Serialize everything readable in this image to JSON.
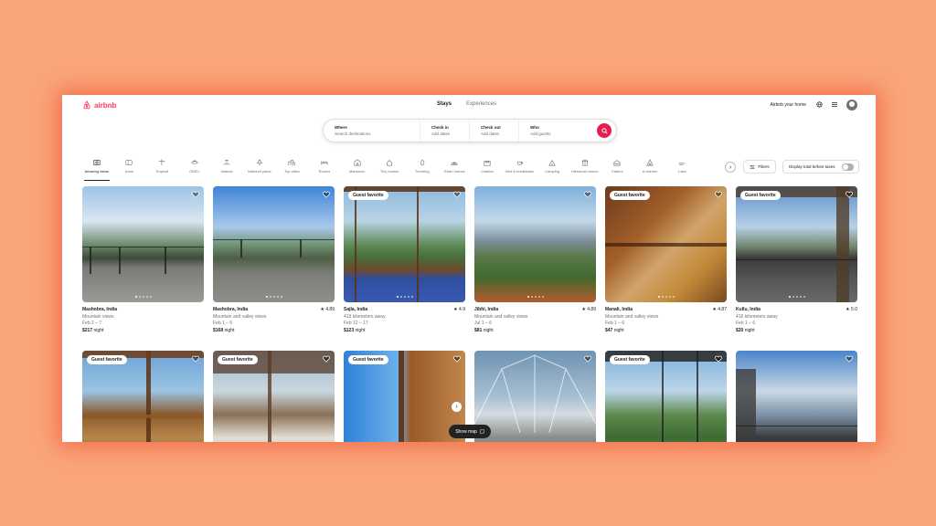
{
  "brand": {
    "name": "airbnb",
    "color": "#ff385c"
  },
  "nav": {
    "tabs": [
      "Stays",
      "Experiences"
    ],
    "host_link": "Airbnb your home"
  },
  "search": {
    "where_label": "Where",
    "where_placeholder": "Search destinations",
    "checkin_label": "Check in",
    "checkin_placeholder": "Add dates",
    "checkout_label": "Check out",
    "checkout_placeholder": "Add dates",
    "who_label": "Who",
    "who_placeholder": "Add guests"
  },
  "categories": [
    {
      "label": "Amazing views",
      "icon": "photo-icon"
    },
    {
      "label": "Icons",
      "icon": "ticket-icon"
    },
    {
      "label": "Tropical",
      "icon": "palm-icon"
    },
    {
      "label": "OMG!",
      "icon": "ufo-icon"
    },
    {
      "label": "Islands",
      "icon": "island-icon"
    },
    {
      "label": "National parks",
      "icon": "tree-icon"
    },
    {
      "label": "Top cities",
      "icon": "city-icon"
    },
    {
      "label": "Rooms",
      "icon": "bed-icon"
    },
    {
      "label": "Mansions",
      "icon": "mansion-icon"
    },
    {
      "label": "Tiny homes",
      "icon": "tiny-home-icon"
    },
    {
      "label": "Trending",
      "icon": "flame-icon"
    },
    {
      "label": "Earth homes",
      "icon": "earth-home-icon"
    },
    {
      "label": "Castles",
      "icon": "castle-icon"
    },
    {
      "label": "Bed & breakfasts",
      "icon": "breakfast-icon"
    },
    {
      "label": "Camping",
      "icon": "tent-icon"
    },
    {
      "label": "Historical homes",
      "icon": "column-icon"
    },
    {
      "label": "Cabins",
      "icon": "cabin-icon"
    },
    {
      "label": "A-frames",
      "icon": "a-frame-icon"
    },
    {
      "label": "Lake",
      "icon": "lake-icon"
    }
  ],
  "filters": {
    "filters_label": "Filters",
    "toggle_label": "Display total before taxes"
  },
  "listings": [
    {
      "location": "Mashobra, India",
      "subtitle": "Mountain views",
      "dates": "Feb 2 – 7",
      "price": "$217",
      "unit": "night",
      "rating": "",
      "guest_favorite": false
    },
    {
      "location": "Mashobra, India",
      "subtitle": "Mountain and valley views",
      "dates": "Feb 1 – 6",
      "price": "$168",
      "unit": "night",
      "rating": "4.89",
      "guest_favorite": false
    },
    {
      "location": "Sajla, India",
      "subtitle": "413 kilometers away",
      "dates": "Feb 12 – 17",
      "price": "$123",
      "unit": "night",
      "rating": "4.9",
      "guest_favorite": true
    },
    {
      "location": "Jibhi, India",
      "subtitle": "Mountain and valley views",
      "dates": "Jul 1 – 6",
      "price": "$81",
      "unit": "night",
      "rating": "4.89",
      "guest_favorite": false
    },
    {
      "location": "Manali, India",
      "subtitle": "Mountain and valley views",
      "dates": "Feb 1 – 6",
      "price": "$47",
      "unit": "night",
      "rating": "4.87",
      "guest_favorite": true
    },
    {
      "location": "Kullu, India",
      "subtitle": "416 kilometers away",
      "dates": "Feb 1 – 6",
      "price": "$20",
      "unit": "night",
      "rating": "5.0",
      "guest_favorite": true
    },
    {
      "guest_favorite": true
    },
    {
      "guest_favorite": true
    },
    {
      "guest_favorite": true
    },
    {
      "guest_favorite": false
    },
    {
      "guest_favorite": true
    },
    {
      "guest_favorite": false
    }
  ],
  "fav_label": "Guest favorite",
  "map_button": "Show map"
}
